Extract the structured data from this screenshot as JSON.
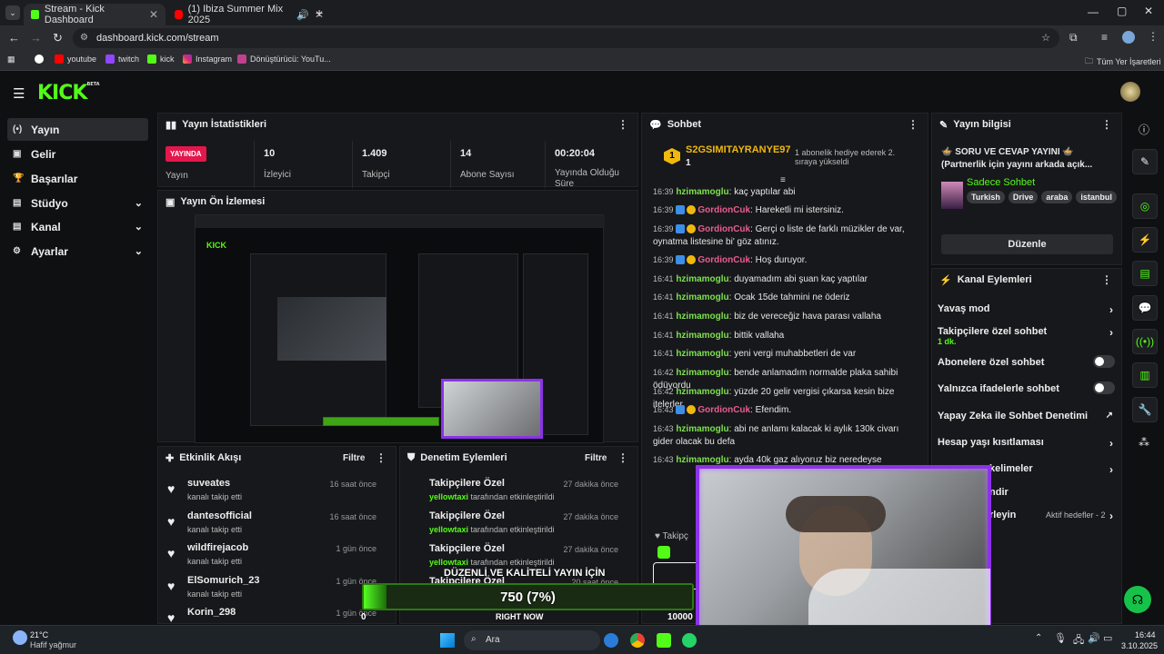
{
  "browser": {
    "tabs": [
      {
        "title": "Stream - Kick Dashboard"
      },
      {
        "title": "(1) Ibiza Summer Mix 2025"
      }
    ],
    "url": "dashboard.kick.com/stream",
    "bookmarks": [
      "youtube",
      "twitch",
      "kick",
      "Instagram",
      "Dönüştürücü: YouTu...",
      "Tüm Yer İşaretleri"
    ]
  },
  "logo": {
    "text": "KICK",
    "sup": "BETA"
  },
  "sidebar": [
    {
      "label": "Yayın",
      "icon": "broadcast-icon"
    },
    {
      "label": "Gelir",
      "icon": "money-icon"
    },
    {
      "label": "Başarılar",
      "icon": "trophy-icon"
    },
    {
      "label": "Stüdyo",
      "icon": "studio-icon"
    },
    {
      "label": "Kanal",
      "icon": "channel-icon"
    },
    {
      "label": "Ayarlar",
      "icon": "gear-icon"
    }
  ],
  "stats": {
    "title": "Yayın İstatistikleri",
    "live_badge": "YAYINDA",
    "live_label": "Yayın",
    "items": [
      {
        "value": "10",
        "label": "İzleyici"
      },
      {
        "value": "1.409",
        "label": "Takipçi"
      },
      {
        "value": "14",
        "label": "Abone Sayısı"
      },
      {
        "value": "00:20:04",
        "label": "Yayında Olduğu Süre"
      }
    ]
  },
  "preview": {
    "title": "Yayın Ön İzlemesi"
  },
  "activity": {
    "title": "Etkinlik Akışı",
    "filter": "Filtre",
    "items": [
      {
        "name": "suveates",
        "sub": "kanalı takip etti",
        "time": "16 saat önce"
      },
      {
        "name": "dantesofficial",
        "sub": "kanalı takip etti",
        "time": "16 saat önce"
      },
      {
        "name": "wildfirejacob",
        "sub": "kanalı takip etti",
        "time": "1 gün önce"
      },
      {
        "name": "ElSomurich_23",
        "sub": "kanalı takip etti",
        "time": "1 gün önce"
      },
      {
        "name": "Korin_298",
        "sub": "",
        "time": "1 gün önce"
      }
    ]
  },
  "moderation": {
    "title": "Denetim Eylemleri",
    "filter": "Filtre",
    "items": [
      {
        "name": "Takipçilere Özel",
        "by": "yellowtaxi",
        "sub": "tarafından etkinleştirildi",
        "time": "27 dakika önce"
      },
      {
        "name": "Takipçilere Özel",
        "by": "yellowtaxi",
        "sub": "tarafından etkinleştirildi",
        "time": "27 dakika önce"
      },
      {
        "name": "Takipçilere Özel",
        "by": "yellowtaxi",
        "sub": "tarafından etkinleştirildi",
        "time": "27 dakika önce"
      },
      {
        "name": "Takipçilere Özel",
        "by": "",
        "sub": "",
        "time": "20 saat önce"
      }
    ]
  },
  "chat": {
    "title": "Sohbet",
    "pinned_user": "S2GSIMITAYRANYE97",
    "pinned_count": "1",
    "pinned_text": "1 abonelik hediye ederek 2. sıraya yükseldi",
    "messages": [
      {
        "time": "16:39",
        "user": "hzimamoglu",
        "text": "kaç yaptılar abi",
        "color": "#7ee04f",
        "badges": 0
      },
      {
        "time": "16:39",
        "user": "GordionCuk",
        "text": "Hareketli mi istersiniz.",
        "color": "#e85d8f",
        "badges": 2
      },
      {
        "time": "16:39",
        "user": "GordionCuk",
        "text": "Gerçi o liste de farklı müzikler de var, oynatma listesine bi' göz atınız.",
        "color": "#e85d8f",
        "badges": 2
      },
      {
        "time": "16:39",
        "user": "GordionCuk",
        "text": "Hoş duruyor.",
        "color": "#e85d8f",
        "badges": 2
      },
      {
        "time": "16:41",
        "user": "hzimamoglu",
        "text": "duyamadım abi şuan kaç yaptılar",
        "color": "#7ee04f",
        "badges": 0
      },
      {
        "time": "16:41",
        "user": "hzimamoglu",
        "text": "Ocak 15de tahmini ne öderiz",
        "color": "#7ee04f",
        "badges": 0
      },
      {
        "time": "16:41",
        "user": "hzimamoglu",
        "text": "biz de vereceğiz hava parası vallaha",
        "color": "#7ee04f",
        "badges": 0
      },
      {
        "time": "16:41",
        "user": "hzimamoglu",
        "text": "bittik vallaha",
        "color": "#7ee04f",
        "badges": 0
      },
      {
        "time": "16:41",
        "user": "hzimamoglu",
        "text": "yeni vergi muhabbetleri de var",
        "color": "#7ee04f",
        "badges": 0
      },
      {
        "time": "16:42",
        "user": "hzimamoglu",
        "text": "bende anlamadım normalde plaka sahibi ödüyordu",
        "color": "#7ee04f",
        "badges": 0
      },
      {
        "time": "16:42",
        "user": "hzimamoglu",
        "text": "yüzde 20 gelir vergisi çıkarsa kesin bize itelerler",
        "color": "#7ee04f",
        "badges": 0
      },
      {
        "time": "16:43",
        "user": "GordionCuk",
        "text": "Efendim.",
        "color": "#e85d8f",
        "badges": 2
      },
      {
        "time": "16:43",
        "user": "hzimamoglu",
        "text": "abi ne anlamı kalacak ki aylık 130k civarı gider olacak bu defa",
        "color": "#7ee04f",
        "badges": 0
      },
      {
        "time": "16:43",
        "user": "hzimamoglu",
        "text": "ayda 40k gaz alıyoruz biz neredeyse",
        "color": "#7ee04f",
        "badges": 0
      }
    ],
    "footer_label": "Takipç"
  },
  "stream_info": {
    "title": "Yayın bilgisi",
    "stream_title": "🍲 SORU VE CEVAP YAYINI 🍲 (Partnerlik için yayını arkada açık...",
    "category": "Sadece Sohbet",
    "tags": [
      "Turkish",
      "Drive",
      "araba",
      "istanbul"
    ],
    "edit_button": "Düzenle"
  },
  "channel_actions": {
    "title": "Kanal Eylemleri",
    "items": [
      {
        "label": "Yavaş mod",
        "control": "chevron"
      },
      {
        "label": "Takipçilere özel sohbet",
        "sub": "1 dk.",
        "control": "chevron"
      },
      {
        "label": "Abonelere özel sohbet",
        "control": "toggle"
      },
      {
        "label": "Yalnızca ifadelerle sohbet",
        "control": "toggle"
      },
      {
        "label": "Yapay Zeka ile Sohbet Denetimi",
        "control": "external"
      },
      {
        "label": "Hesap yaşı kısıtlaması",
        "control": "chevron"
      },
      {
        "label": "kelimeler",
        "control": "chevron"
      },
      {
        "label": "ndir",
        "control": "none"
      },
      {
        "label": "rleyin",
        "sub": "Aktif hedefler - 2",
        "control": "chevron"
      }
    ]
  },
  "overlay": {
    "goal_title": "DÜZENLİ VE KALİTELİ YAYIN İÇİN",
    "goal_value": "750 (7%)",
    "goal_percent": 7,
    "goal_start": "0",
    "goal_end": "10000",
    "goal_footer": "RIGHT NOW"
  },
  "taskbar": {
    "weather_temp": "21°C",
    "weather_desc": "Hafif yağmur",
    "search": "Ara",
    "time": "16:44",
    "date": "3.10.2025"
  }
}
